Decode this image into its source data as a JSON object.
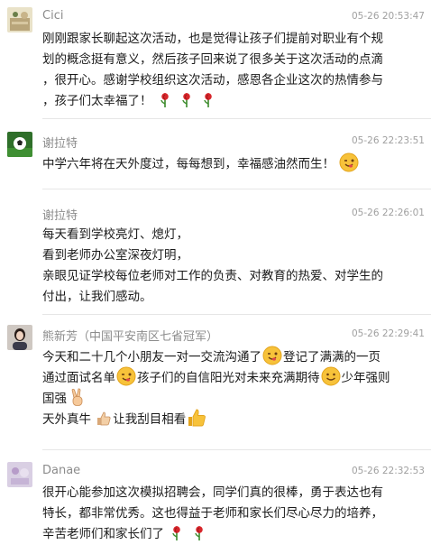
{
  "comments": [
    {
      "name": "Cici",
      "time": "05-26 20:53:47",
      "lines": [
        "刚刚跟家长聊起这次活动，也是觉得让孩子们提前对职业有个规",
        "划的概念挺有意义，然后孩子回来说了很多关于这次活动的点滴",
        "，很开心。感谢学校组织这次活动，感恩各企业这次的热情参与",
        "，孩子们太幸福了！"
      ]
    },
    {
      "name": "谢拉特",
      "time": "05-26 22:23:51",
      "lines": [
        "中学六年将在天外度过，每每想到，幸福感油然而生！"
      ]
    },
    {
      "name": "谢拉特",
      "time": "05-26 22:26:01",
      "lines": [
        "每天看到学校亮灯、熄灯，",
        "看到老师办公室深夜灯明，",
        "亲眼见证学校每位老师对工作的负责、对教育的热爱、对学生的",
        "付出，让我们感动。"
      ]
    },
    {
      "name": "熊新芳（中国平安南区七省冠军）",
      "time": "05-26 22:29:41",
      "lines": {
        "l1a": "今天和二十几个小朋友一对一交流沟通了",
        "l1b": "登记了满满的一页",
        "l2a": "通过面试名单",
        "l2b": "孩子们的自信阳光对未来充满期待",
        "l2c": "少年强则",
        "l3a": "国强",
        "l4a": "天外真牛",
        "l4b": "让我刮目相看"
      }
    },
    {
      "name": "Danae",
      "time": "05-26 22:32:53",
      "lines": [
        "很开心能参加这次模拟招聘会，同学们真的很棒，勇于表达也有",
        "特长，都非常优秀。这也得益于老师和家长们尽心尽力的培养，",
        "辛苦老师们和家长们了"
      ]
    }
  ],
  "icons": [
    "rose-icon",
    "wink-icon",
    "smile-icon",
    "victory-hand-icon",
    "thumbs-up-icon"
  ]
}
